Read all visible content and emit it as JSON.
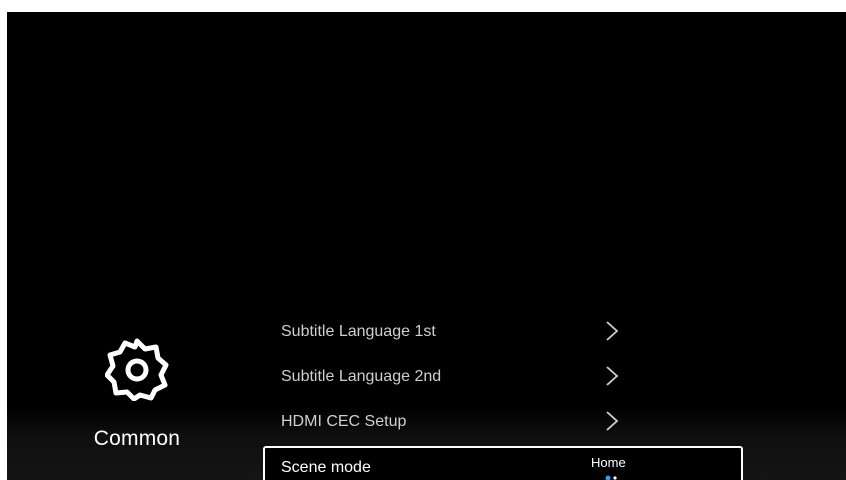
{
  "category": {
    "label": "Common",
    "icon": "gear-icon"
  },
  "menu": {
    "items": [
      {
        "label": "Subtitle Language 1st",
        "icon": "chevron-right-icon"
      },
      {
        "label": "Subtitle Language 2nd",
        "icon": "chevron-right-icon"
      },
      {
        "label": "HDMI CEC Setup",
        "icon": "chevron-right-icon"
      },
      {
        "label": "Scene mode",
        "value": "Home",
        "icon": "option-dots-icon"
      }
    ]
  },
  "colors": {
    "background": "#000000",
    "text": "#ffffff",
    "muted_text": "#cfcfcf",
    "accent": "#2a9df4"
  }
}
